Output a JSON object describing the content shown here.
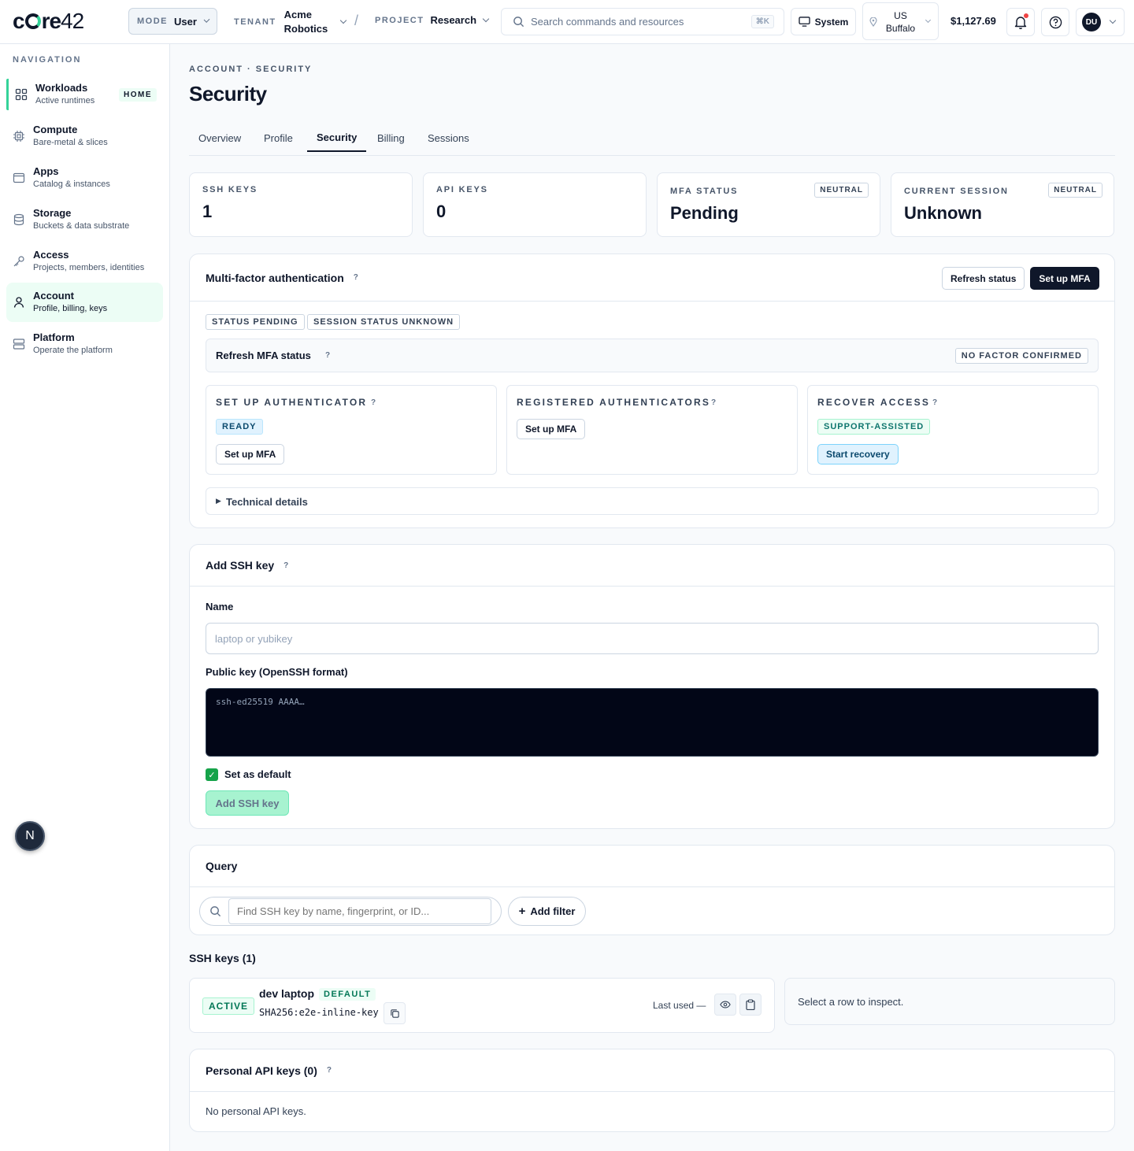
{
  "brand": {
    "logo_prefix": "c",
    "logo_mid": "re",
    "logo_num": "42"
  },
  "topbar": {
    "mode_label": "MODE",
    "mode_value": "User",
    "tenant_label": "TENANT",
    "tenant_value": "Acme Robotics",
    "separator": "/",
    "project_label": "PROJECT",
    "project_value": "Research",
    "search_placeholder": "Search commands and resources",
    "search_shortcut": "⌘K",
    "theme_label": "System",
    "region_line1": "US",
    "region_line2": "Buffalo",
    "balance": "$1,127.69",
    "avatar_initials": "DU"
  },
  "sidebar": {
    "heading": "NAVIGATION",
    "items": [
      {
        "title": "Workloads",
        "sub": "Active runtimes",
        "badge": "HOME",
        "icon": "grid-icon"
      },
      {
        "title": "Compute",
        "sub": "Bare-metal & slices",
        "icon": "chip-icon"
      },
      {
        "title": "Apps",
        "sub": "Catalog & instances",
        "icon": "window-icon"
      },
      {
        "title": "Storage",
        "sub": "Buckets & data substrate",
        "icon": "database-icon"
      },
      {
        "title": "Access",
        "sub": "Projects, members, identities",
        "icon": "key-icon"
      },
      {
        "title": "Account",
        "sub": "Profile, billing, keys",
        "icon": "user-icon"
      },
      {
        "title": "Platform",
        "sub": "Operate the platform",
        "icon": "server-icon"
      }
    ],
    "fab_label": "N"
  },
  "page": {
    "breadcrumb": "ACCOUNT · SECURITY",
    "title": "Security",
    "tabs": [
      "Overview",
      "Profile",
      "Security",
      "Billing",
      "Sessions"
    ]
  },
  "stats": [
    {
      "label": "SSH KEYS",
      "value": "1"
    },
    {
      "label": "API KEYS",
      "value": "0"
    },
    {
      "label": "MFA STATUS",
      "value": "Pending",
      "badge": "NEUTRAL"
    },
    {
      "label": "CURRENT SESSION",
      "value": "Unknown",
      "badge": "NEUTRAL"
    }
  ],
  "mfa": {
    "title": "Multi-factor authentication",
    "help": "?",
    "refresh_btn": "Refresh status",
    "setup_btn": "Set up MFA",
    "tag_status": "STATUS PENDING",
    "tag_session": "SESSION STATUS UNKNOWN",
    "refresh_title": "Refresh MFA status",
    "refresh_tag": "NO FACTOR CONFIRMED",
    "panels": [
      {
        "title": "SET UP AUTHENTICATOR",
        "tag": "READY",
        "button": "Set up MFA"
      },
      {
        "title": "REGISTERED AUTHENTICATORS",
        "button": "Set up MFA"
      },
      {
        "title": "RECOVER ACCESS",
        "tag": "SUPPORT-ASSISTED",
        "button": "Start recovery"
      }
    ],
    "technical_details": "Technical details"
  },
  "ssh_form": {
    "title": "Add SSH key",
    "name_label": "Name",
    "name_placeholder": "laptop or yubikey",
    "key_label": "Public key (OpenSSH format)",
    "key_placeholder": "ssh-ed25519 AAAA…",
    "default_label": "Set as default",
    "submit": "Add SSH key"
  },
  "query": {
    "title": "Query",
    "placeholder": "Find SSH key by name, fingerprint, or ID...",
    "add_filter": "Add filter"
  },
  "ssh_list": {
    "heading": "SSH keys (1)",
    "row": {
      "status": "ACTIVE",
      "name": "dev laptop",
      "default_tag": "DEFAULT",
      "fingerprint": "SHA256:e2e-inline-key",
      "last_used": "Last used —"
    },
    "inspect_hint": "Select a row to inspect."
  },
  "api_keys": {
    "title": "Personal API keys (0)",
    "empty": "No personal API keys."
  },
  "colors": {
    "accent": "#34d399",
    "dark": "#0f172a",
    "active_bg": "#ecfdf5"
  }
}
